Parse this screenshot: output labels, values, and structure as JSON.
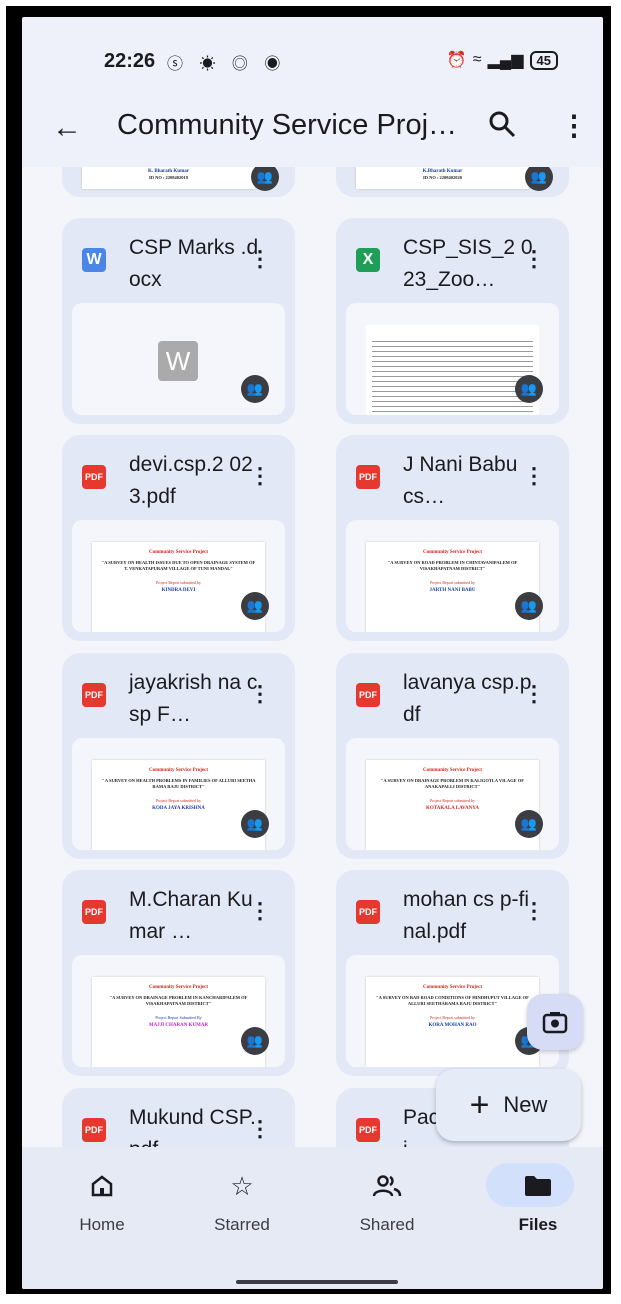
{
  "status": {
    "time": "22:26",
    "left_icons": "ⓢ ☀ ◎ ◉",
    "battery": "45"
  },
  "appbar": {
    "title": "Community Service Proj…"
  },
  "top_strip": [
    {
      "line1": "K. Bharath Kumar",
      "line2": "ID NO : 2208402019"
    },
    {
      "line1": "K.Bharath Kumar",
      "line2": "ID NO : 2208402020"
    }
  ],
  "files": [
    {
      "name": "CSP Marks .docx",
      "type": "W",
      "thumb": "word"
    },
    {
      "name": "CSP_SIS_2 023_Zoo…",
      "type": "X",
      "thumb": "sheet"
    },
    {
      "name": "devi.csp.2 023.pdf",
      "type": "PDF",
      "thumb": "doc",
      "p_title": "Community Service Project",
      "p_body": "\"A SURVEY ON HEALTH ISSUES DUE TO OPEN DRAINAGE SYSTEM OF T. VENKATAPURAM VILLAGE OF TUNI MANDAL\"",
      "p_small": "Project Report submitted by",
      "p_name": "KINDRA DEVI"
    },
    {
      "name": "J Nani Babu cs…",
      "type": "PDF",
      "thumb": "doc",
      "p_title": "Community Service Project",
      "p_body": "\"A SURVEY ON ROAD PROBLEM IN CHINTAVANIPALEM OF VISAKHAPATNAM DISTRICT\"",
      "p_small": "Project Report submitted by",
      "p_name": "JARTH NANI BABU"
    },
    {
      "name": "jayakrish na csp F…",
      "type": "PDF",
      "thumb": "doc",
      "p_title": "Community Service Project",
      "p_body": "\" A SURVEY ON HEALTH PROBLEMS IN FAMILIES OF ALLURI SEETHA RAMA RAJU DISTRICT\"",
      "p_small": "Project Report submitted by",
      "p_name": "KODA JAYA KRISHNA"
    },
    {
      "name": "lavanya csp.pdf",
      "type": "PDF",
      "thumb": "doc",
      "p_title": "Community Service Project",
      "p_body": "\"A SURVEY ON DRAINAGE PROBLEM IN KALIGOTLA VILAGE OF ANAKAPALLI DISTRICT\"",
      "p_small": "Project Report submitted by",
      "p_name": "KOTAKALA LAVANYA"
    },
    {
      "name": "M.Charan Kumar …",
      "type": "PDF",
      "thumb": "doc",
      "p_title": "Community Service Project",
      "p_body": "\"A SURVEY ON DRAINAGE PROBLEM IN KANCHARIPALEM OF VISAKHAPATNAM DISTRICT\"",
      "p_small": "Project Report Submitted By",
      "p_name": "MAJJI CHARAN KUMAR"
    },
    {
      "name": "mohan cs p-final.pdf",
      "type": "PDF",
      "thumb": "doc",
      "p_title": "Community Service Project",
      "p_body": "\"A SURVEY ON BAD ROAD CONDITIONS OF HINDHUPUT VILLAGE OF ALLURI SEETHARAMA RAJU DISTRICT\"",
      "p_small": "Project Report submitted by",
      "p_name": "KORA MOHAN RAO"
    },
    {
      "name": "Mukund CSP.pdf",
      "type": "PDF",
      "thumb": "none"
    },
    {
      "name": "Pac CSP proj…",
      "type": "PDF",
      "thumb": "none"
    }
  ],
  "fab": {
    "new_label": "New"
  },
  "nav": [
    {
      "label": "Home"
    },
    {
      "label": "Starred"
    },
    {
      "label": "Shared"
    },
    {
      "label": "Files"
    }
  ]
}
